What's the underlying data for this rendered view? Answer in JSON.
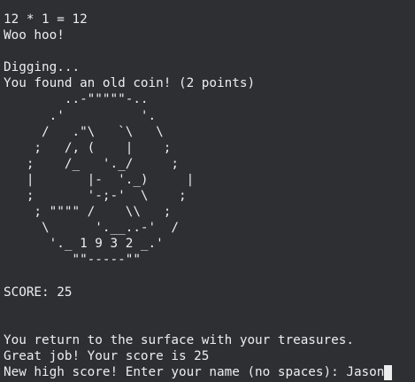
{
  "terminal": {
    "lines_top": [
      "12 * 1 = 12",
      "Woo hoo!",
      "",
      "Digging...",
      "You found an old coin! (2 points)"
    ],
    "coin_art": [
      "        ..-\"\"\"\"\"-..",
      "      .'          '.",
      "     /   .\"\\   `\\   \\",
      "    ;   /, (    |    ;",
      "   ;    /_   '._/     ;",
      "   |       |-  '._)     |",
      "   ;       '-;-'  \\    ;",
      "    ; \"\"\"\" /    \\\\   ;",
      "     \\      '.__..-'  /",
      "      '._ 1 9 3 2 _.'",
      "         \"\"-----\"\""
    ],
    "score_text": "SCORE: 25",
    "lines_bottom": [
      "You return to the surface with your treasures.",
      "Great job! Your score is 25"
    ],
    "prompt": "New high score! Enter your name (no spaces): ",
    "input_value": "Jason"
  }
}
